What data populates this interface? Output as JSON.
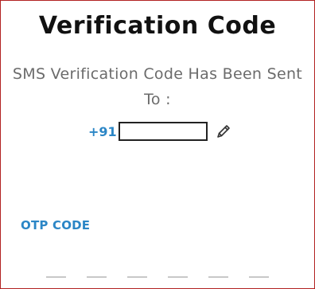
{
  "header": {
    "title": "Verification Code",
    "subtitle_line1": "SMS Verification Code Has Been Sent",
    "subtitle_line2": "To :"
  },
  "phone": {
    "country_code": "+91",
    "number_value": "",
    "edit_icon": "pencil-icon"
  },
  "otp": {
    "label": "OTP CODE",
    "digits": [
      "",
      "",
      "",
      "",
      "",
      ""
    ]
  },
  "colors": {
    "accent": "#2b86c6",
    "border": "#b22222",
    "title": "#111111",
    "subtitle": "#6b6b6b"
  }
}
